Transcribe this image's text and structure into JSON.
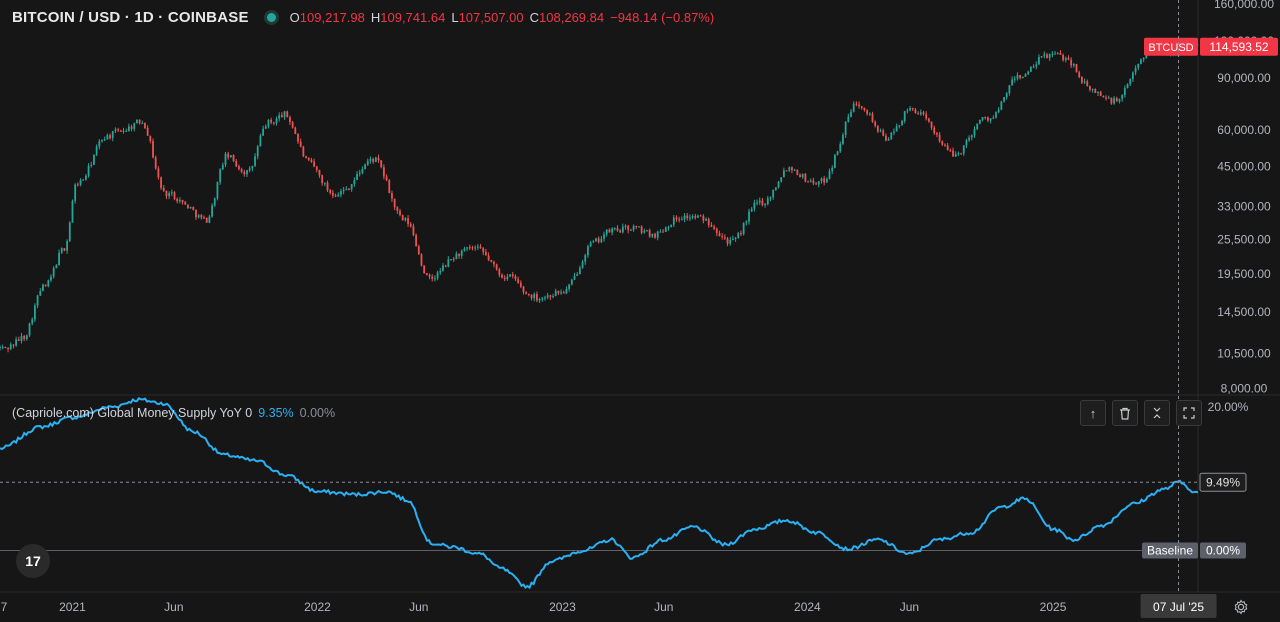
{
  "header": {
    "symbol": "BITCOIN / USD · 1D · COINBASE",
    "open_key": "O",
    "open": "109,217.98",
    "high_key": "H",
    "high": "109,741.64",
    "low_key": "L",
    "low": "107,507.00",
    "close_key": "C",
    "close": "108,269.84",
    "change": "−948.14 (−0.87%)"
  },
  "indicator": {
    "name": "(Capriole.com) Global Money Supply YoY 0",
    "value": "9.35%",
    "value2": "0.00%"
  },
  "tool_icons": [
    "arrow-up-icon",
    "trash-icon",
    "collapse-icon",
    "maximize-icon"
  ],
  "colors": {
    "background": "#161616",
    "up": "#26a69a",
    "down": "#ef5350",
    "indicator_line": "#2ab0f5",
    "price_tag": "#f23645",
    "crosshair_label": "#3a3a3a"
  },
  "chart_data": [
    {
      "type": "candlestick",
      "title": "BITCOIN / USD · 1D · COINBASE",
      "yscale": "log",
      "ylim": [
        7600,
        165000
      ],
      "y_ticks": [
        {
          "value": 160000,
          "label": "160,000.00"
        },
        {
          "value": 120000,
          "label": "120,000.00"
        },
        {
          "value": 90000,
          "label": "90,000.00"
        },
        {
          "value": 60000,
          "label": "60,000.00"
        },
        {
          "value": 45000,
          "label": "45,000.00"
        },
        {
          "value": 33000,
          "label": "33,000.00"
        },
        {
          "value": 25500,
          "label": "25,500.00"
        },
        {
          "value": 19500,
          "label": "19,500.00"
        },
        {
          "value": 14500,
          "label": "14,500.00"
        },
        {
          "value": 10500,
          "label": "10,500.00"
        },
        {
          "value": 8000,
          "label": "8,000.00"
        }
      ],
      "price_tag": {
        "name": "BTCUSD",
        "value": 114593.52,
        "label": "114,593.52"
      },
      "x_range": [
        "2020-09-15",
        "2025-08-05"
      ],
      "series_points": [
        [
          "2020-09-15",
          11000
        ],
        [
          "2020-10-20",
          11800
        ],
        [
          "2020-11-20",
          18000
        ],
        [
          "2020-12-20",
          23500
        ],
        [
          "2021-01-08",
          40000
        ],
        [
          "2021-02-20",
          56000
        ],
        [
          "2021-03-15",
          61000
        ],
        [
          "2021-04-14",
          63000
        ],
        [
          "2021-05-20",
          37000
        ],
        [
          "2021-06-20",
          33000
        ],
        [
          "2021-07-20",
          30000
        ],
        [
          "2021-08-20",
          49000
        ],
        [
          "2021-09-20",
          43000
        ],
        [
          "2021-10-20",
          64000
        ],
        [
          "2021-11-10",
          68000
        ],
        [
          "2021-12-20",
          47000
        ],
        [
          "2022-01-24",
          36000
        ],
        [
          "2022-03-28",
          47000
        ],
        [
          "2022-05-12",
          29000
        ],
        [
          "2022-06-18",
          19000
        ],
        [
          "2022-08-15",
          24000
        ],
        [
          "2022-10-15",
          19200
        ],
        [
          "2022-11-09",
          16500
        ],
        [
          "2022-12-30",
          16600
        ],
        [
          "2023-02-15",
          24500
        ],
        [
          "2023-03-20",
          28000
        ],
        [
          "2023-05-15",
          27000
        ],
        [
          "2023-07-13",
          31000
        ],
        [
          "2023-09-11",
          25500
        ],
        [
          "2023-10-25",
          34500
        ],
        [
          "2023-12-05",
          44000
        ],
        [
          "2024-01-22",
          39500
        ],
        [
          "2024-03-14",
          73000
        ],
        [
          "2024-05-01",
          57000
        ],
        [
          "2024-06-07",
          71000
        ],
        [
          "2024-08-05",
          50000
        ],
        [
          "2024-09-27",
          66000
        ],
        [
          "2024-11-12",
          90000
        ],
        [
          "2024-12-17",
          106000
        ],
        [
          "2025-01-21",
          106000
        ],
        [
          "2025-02-28",
          80000
        ],
        [
          "2025-04-08",
          76000
        ],
        [
          "2025-05-22",
          111000
        ],
        [
          "2025-07-07",
          108270
        ],
        [
          "2025-07-14",
          119000
        ],
        [
          "2025-08-05",
          114600
        ]
      ]
    },
    {
      "type": "line",
      "title": "(Capriole.com) Global Money Supply YoY 0",
      "ylim": [
        -5.5,
        21.5
      ],
      "y_ticks": [
        {
          "value": 20,
          "label": "20.00%"
        }
      ],
      "current_label": "9.49%",
      "baseline": {
        "value": 0,
        "label": "Baseline",
        "value_label": "0.00%"
      },
      "series_points": [
        [
          "2020-09-15",
          14.2
        ],
        [
          "2020-11-15",
          17.2
        ],
        [
          "2021-01-01",
          18.5
        ],
        [
          "2021-03-01",
          20.0
        ],
        [
          "2021-04-10",
          21.0
        ],
        [
          "2021-05-15",
          20.5
        ],
        [
          "2021-07-01",
          16.5
        ],
        [
          "2021-08-15",
          13.3
        ],
        [
          "2021-10-01",
          12.5
        ],
        [
          "2021-11-15",
          10.5
        ],
        [
          "2022-01-01",
          8.2
        ],
        [
          "2022-03-01",
          7.8
        ],
        [
          "2022-04-15",
          8.2
        ],
        [
          "2022-05-15",
          7.0
        ],
        [
          "2022-06-20",
          1.0
        ],
        [
          "2022-07-20",
          0.5
        ],
        [
          "2022-09-01",
          -0.5
        ],
        [
          "2022-10-01",
          -2.5
        ],
        [
          "2022-11-10",
          -5.0
        ],
        [
          "2022-12-15",
          -1.5
        ],
        [
          "2023-02-01",
          0.0
        ],
        [
          "2023-03-15",
          1.5
        ],
        [
          "2023-04-15",
          -1.0
        ],
        [
          "2023-06-01",
          1.5
        ],
        [
          "2023-07-15",
          3.3
        ],
        [
          "2023-09-01",
          0.8
        ],
        [
          "2023-10-15",
          3.0
        ],
        [
          "2023-12-01",
          4.2
        ],
        [
          "2024-01-15",
          2.5
        ],
        [
          "2024-03-01",
          0.2
        ],
        [
          "2024-04-15",
          1.5
        ],
        [
          "2024-06-01",
          -0.5
        ],
        [
          "2024-07-15",
          1.5
        ],
        [
          "2024-09-01",
          2.5
        ],
        [
          "2024-10-15",
          6.0
        ],
        [
          "2024-11-20",
          7.2
        ],
        [
          "2025-01-01",
          3.0
        ],
        [
          "2025-02-01",
          1.5
        ],
        [
          "2025-03-15",
          3.5
        ],
        [
          "2025-05-01",
          6.5
        ],
        [
          "2025-06-15",
          8.5
        ],
        [
          "2025-07-07",
          9.49
        ],
        [
          "2025-08-05",
          8.0
        ]
      ]
    }
  ],
  "x_axis": {
    "ticks": [
      {
        "date": "2020-09-01",
        "label": "7"
      },
      {
        "date": "2021-01-01",
        "label": "2021"
      },
      {
        "date": "2021-06-01",
        "label": "Jun"
      },
      {
        "date": "2022-01-01",
        "label": "2022"
      },
      {
        "date": "2022-06-01",
        "label": "Jun"
      },
      {
        "date": "2023-01-01",
        "label": "2023"
      },
      {
        "date": "2023-06-01",
        "label": "Jun"
      },
      {
        "date": "2024-01-01",
        "label": "2024"
      },
      {
        "date": "2024-06-01",
        "label": "Jun"
      },
      {
        "date": "2025-01-01",
        "label": "2025"
      }
    ],
    "crosshair_date": "2025-07-07",
    "crosshair_label": "07 Jul '25"
  },
  "logo_text": "17"
}
